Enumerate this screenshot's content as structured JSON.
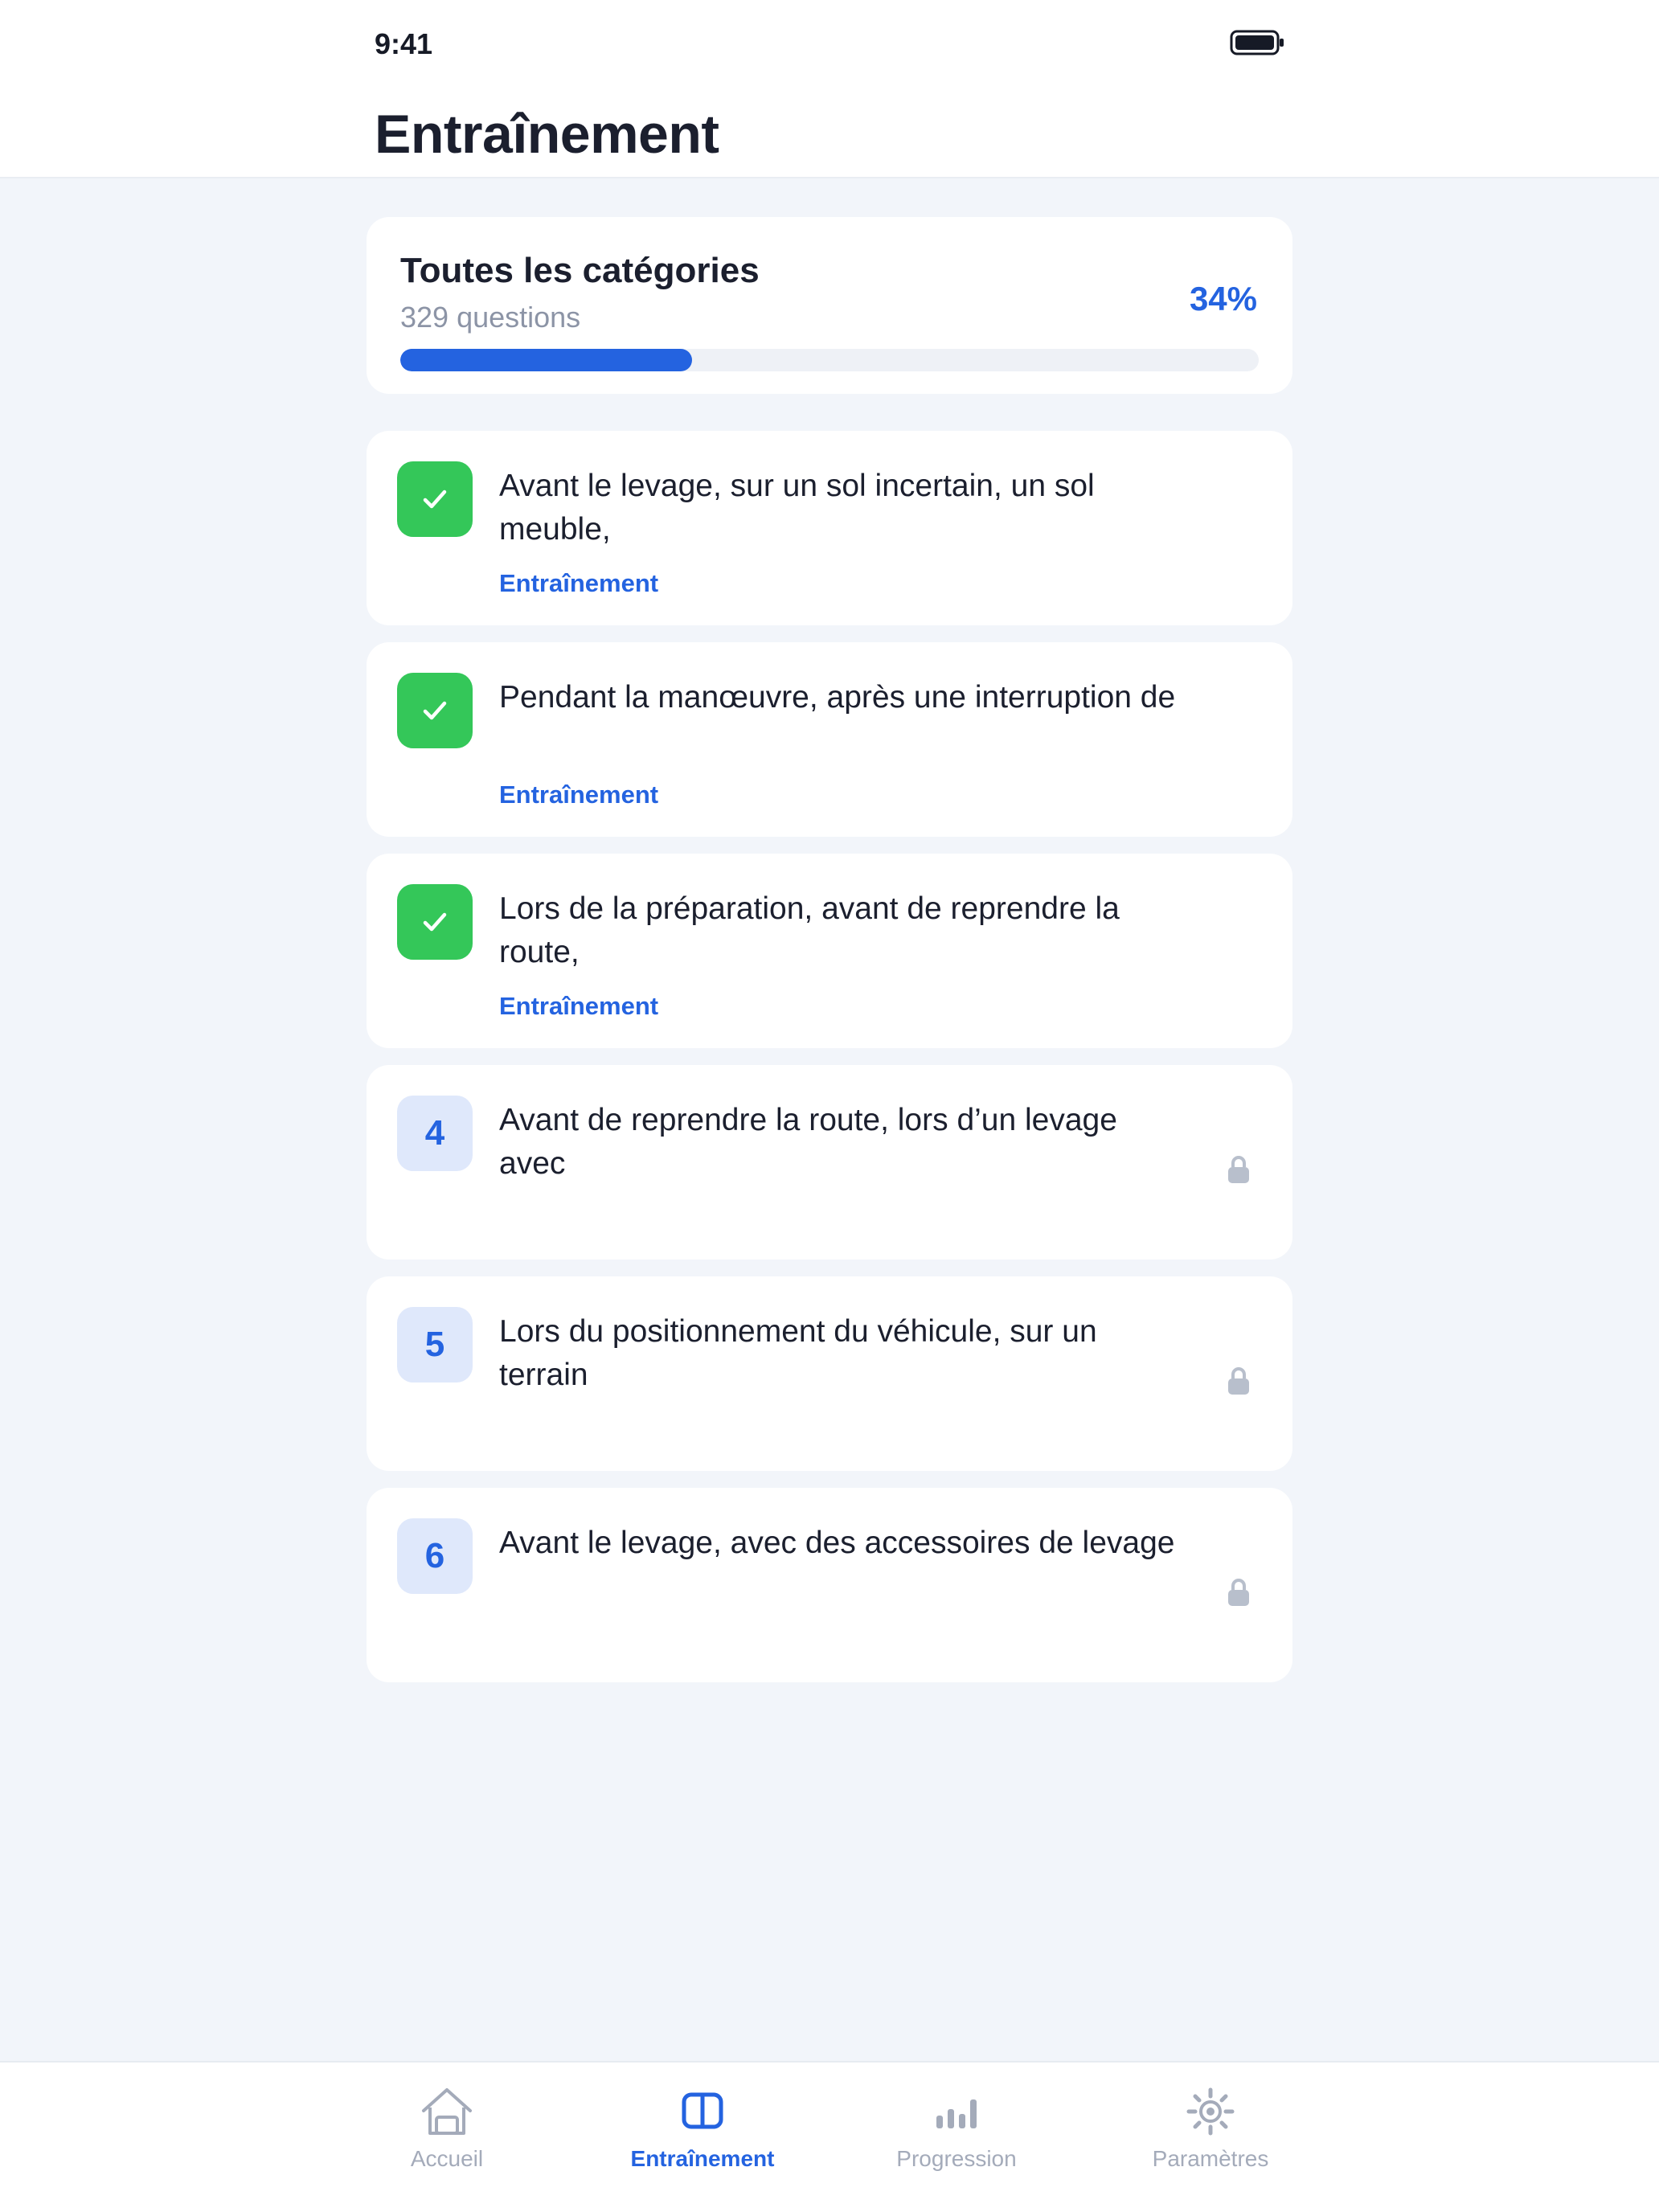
{
  "status_bar": {
    "time": "9:41"
  },
  "header": {
    "title": "Entraînement"
  },
  "summary": {
    "title": "Toutes les catégories",
    "subtitle": "329 questions",
    "percent_label": "34%",
    "progress": 0.34
  },
  "questions": [
    {
      "status": "done",
      "badge": "",
      "text": "Avant le levage, sur un sol incertain, un sol meuble,",
      "tag": "Entraînement",
      "icon": "check-icon"
    },
    {
      "status": "done",
      "badge": "",
      "text": "Pendant la manœuvre, après une interruption de",
      "tag": "Entraînement",
      "icon": "check-icon"
    },
    {
      "status": "done",
      "badge": "",
      "text": "Lors de la préparation, avant de reprendre la route,",
      "tag": "Entraînement",
      "icon": "check-icon"
    },
    {
      "status": "locked",
      "badge": "4",
      "text": "Avant de reprendre la route, lors d’un levage avec",
      "tag": "",
      "icon": "lock-icon"
    },
    {
      "status": "locked",
      "badge": "5",
      "text": "Lors du positionnement du véhicule, sur un terrain",
      "tag": "",
      "icon": "lock-icon"
    },
    {
      "status": "locked",
      "badge": "6",
      "text": "Avant le levage, avec des accessoires de levage",
      "tag": "",
      "icon": "lock-icon"
    }
  ],
  "tabbar": {
    "items": [
      {
        "label": "Accueil",
        "icon": "home-icon",
        "active": false
      },
      {
        "label": "Entraînement",
        "icon": "book-icon",
        "active": true
      },
      {
        "label": "Progression",
        "icon": "bar-chart-icon",
        "active": false
      },
      {
        "label": "Paramètres",
        "icon": "gear-icon",
        "active": false
      }
    ]
  },
  "colors": {
    "accent": "#2463e0",
    "success": "#34c759",
    "background": "#f2f5fa",
    "muted": "#a4abba"
  }
}
